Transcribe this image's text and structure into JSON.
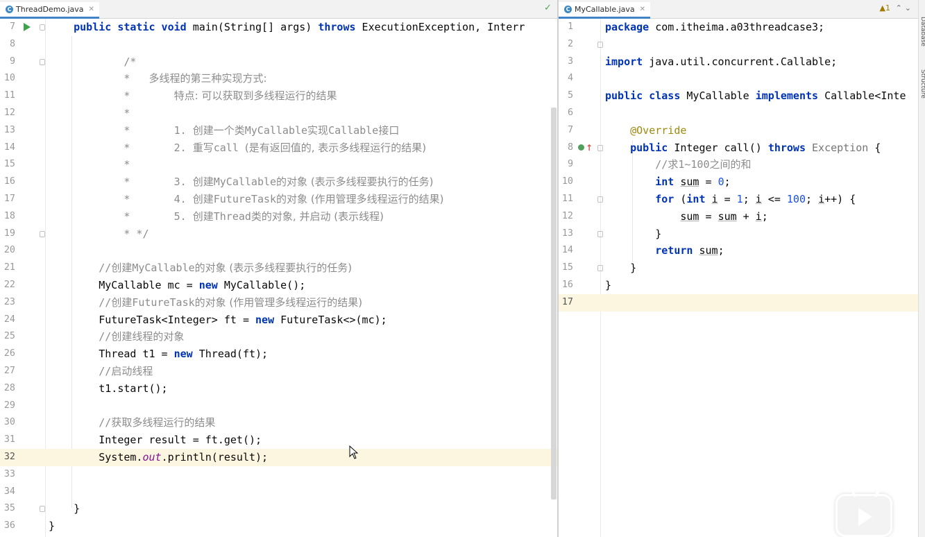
{
  "left": {
    "tab_label": "ThreadDemo.java",
    "tab_icon": "java-class-icon",
    "status_check": "✓",
    "lines": [
      {
        "n": "7",
        "html": "    <span class=\"kw\">public static void</span> main(String[] args) <span class=\"kw\">throws</span> ExecutionException, Interr"
      },
      {
        "n": "8",
        "html": ""
      },
      {
        "n": "9",
        "html": "            <span class=\"cm\">/*</span>"
      },
      {
        "n": "10",
        "html": "            <span class=\"cm\">*   <span class=\"cn\">多线程的第三种实现方式:</span></span>"
      },
      {
        "n": "11",
        "html": "            <span class=\"cm\">*       <span class=\"cn\">特点: 可以获取到多线程运行的结果</span></span>"
      },
      {
        "n": "12",
        "html": "            <span class=\"cm\">*</span>"
      },
      {
        "n": "13",
        "html": "            <span class=\"cm\">*       1. <span class=\"cn\">创建一个类</span>MyCallable<span class=\"cn\">实现</span>Callable<span class=\"cn\">接口</span></span>"
      },
      {
        "n": "14",
        "html": "            <span class=\"cm\">*       2. <span class=\"cn\">重写</span>call <span class=\"cn\">(是有返回值的, 表示多线程运行的结果)</span></span>"
      },
      {
        "n": "15",
        "html": "            <span class=\"cm\">*</span>"
      },
      {
        "n": "16",
        "html": "            <span class=\"cm\">*       3. <span class=\"cn\">创建</span>MyCallable<span class=\"cn\">的对象 (表示多线程要执行的任务)</span></span>"
      },
      {
        "n": "17",
        "html": "            <span class=\"cm\">*       4. <span class=\"cn\">创建</span>FutureTask<span class=\"cn\">的对象 (作用管理多线程运行的结果)</span></span>"
      },
      {
        "n": "18",
        "html": "            <span class=\"cm\">*       5. <span class=\"cn\">创建</span>Thread<span class=\"cn\">类的对象, 并启动 (表示线程)</span></span>"
      },
      {
        "n": "19",
        "html": "            <span class=\"cm\">* */</span>"
      },
      {
        "n": "20",
        "html": ""
      },
      {
        "n": "21",
        "html": "        <span class=\"cm\">//<span class=\"cn\">创建</span>MyCallable<span class=\"cn\">的对象 (表示多线程要执行的任务)</span></span>"
      },
      {
        "n": "22",
        "html": "        MyCallable mc = <span class=\"kw\">new</span> MyCallable();"
      },
      {
        "n": "23",
        "html": "        <span class=\"cm\">//<span class=\"cn\">创建</span>FutureTask<span class=\"cn\">的对象 (作用管理多线程运行的结果)</span></span>"
      },
      {
        "n": "24",
        "html": "        FutureTask&lt;Integer&gt; ft = <span class=\"kw\">new</span> FutureTask&lt;&gt;(mc);"
      },
      {
        "n": "25",
        "html": "        <span class=\"cm\">//<span class=\"cn\">创建线程的对象</span></span>"
      },
      {
        "n": "26",
        "html": "        Thread t1 = <span class=\"kw\">new</span> Thread(ft);"
      },
      {
        "n": "27",
        "html": "        <span class=\"cm\">//<span class=\"cn\">启动线程</span></span>"
      },
      {
        "n": "28",
        "html": "        t1.start();"
      },
      {
        "n": "29",
        "html": ""
      },
      {
        "n": "30",
        "html": "        <span class=\"cm\">//<span class=\"cn\">获取多线程运行的结果</span></span>"
      },
      {
        "n": "31",
        "html": "        Integer result = ft.get();"
      },
      {
        "n": "32",
        "html": "        System.<span class=\"st\">out</span>.println(result);"
      },
      {
        "n": "33",
        "html": ""
      },
      {
        "n": "34",
        "html": ""
      },
      {
        "n": "35",
        "html": "    }"
      },
      {
        "n": "36",
        "html": "}"
      }
    ]
  },
  "right": {
    "tab_label": "MyCallable.java",
    "tab_icon": "java-class-icon",
    "warning_count": "▲1",
    "nav_arrows": "⌃⌄",
    "lines": [
      {
        "n": "1",
        "html": "<span class=\"kw\">package</span> com.itheima.a03threadcase3;"
      },
      {
        "n": "2",
        "html": ""
      },
      {
        "n": "3",
        "html": "<span class=\"kw\">import</span> java.util.concurrent.Callable;"
      },
      {
        "n": "4",
        "html": ""
      },
      {
        "n": "5",
        "html": "<span class=\"kw\">public class</span> MyCallable <span class=\"kw\">implements</span> Callable&lt;Inte"
      },
      {
        "n": "6",
        "html": ""
      },
      {
        "n": "7",
        "html": "    <span class=\"an\">@Override</span>"
      },
      {
        "n": "8",
        "html": "    <span class=\"kw\">public</span> Integer call() <span class=\"kw\">throws</span> <span class=\"gr\">Exception</span> {"
      },
      {
        "n": "9",
        "html": "        <span class=\"cm\">//<span class=\"cn\">求</span>1~100<span class=\"cn\">之间的和</span></span>"
      },
      {
        "n": "10",
        "html": "        <span class=\"kw\">int</span> <span class=\"ul\">sum</span> = <span class=\"num\">0</span>;"
      },
      {
        "n": "11",
        "html": "        <span class=\"kw\">for</span> (<span class=\"kw\">int</span> <span class=\"ul\">i</span> = <span class=\"num\">1</span>; <span class=\"ul\">i</span> &lt;= <span class=\"num\">100</span>; <span class=\"ul\">i</span>++) {"
      },
      {
        "n": "12",
        "html": "            <span class=\"ul\">sum</span> = <span class=\"ul\">sum</span> + <span class=\"ul\">i</span>;"
      },
      {
        "n": "13",
        "html": "        }"
      },
      {
        "n": "14",
        "html": "        <span class=\"kw\">return</span> <span class=\"ul\">sum</span>;"
      },
      {
        "n": "15",
        "html": "    }"
      },
      {
        "n": "16",
        "html": "}"
      },
      {
        "n": "17",
        "html": ""
      }
    ]
  },
  "side_tool_labels": [
    "Database",
    "Structure"
  ]
}
